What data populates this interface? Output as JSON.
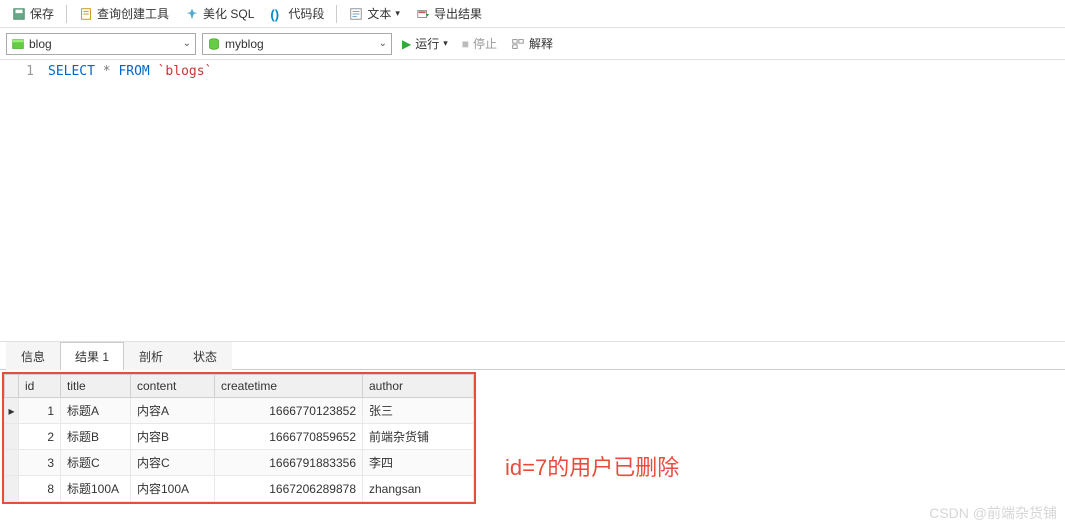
{
  "toolbar": {
    "save": "保存",
    "query_builder": "查询创建工具",
    "beautify_sql": "美化 SQL",
    "code_snippet": "代码段",
    "text": "文本",
    "export": "导出结果"
  },
  "sub_toolbar": {
    "db_select": "blog",
    "table_select": "myblog",
    "run": "运行",
    "stop": "停止",
    "explain": "解释"
  },
  "editor": {
    "line_no": "1",
    "sql_select": "SELECT",
    "sql_star": "*",
    "sql_from": "FROM",
    "sql_table": "`blogs`"
  },
  "tabs": {
    "info": "信息",
    "result1": "结果 1",
    "profile": "剖析",
    "status": "状态"
  },
  "result": {
    "headers": {
      "id": "id",
      "title": "title",
      "content": "content",
      "createtime": "createtime",
      "author": "author"
    },
    "rows": [
      {
        "id": "1",
        "title": "标题A",
        "content": "内容A",
        "createtime": "1666770123852",
        "author": "张三",
        "selected": true
      },
      {
        "id": "2",
        "title": "标题B",
        "content": "内容B",
        "createtime": "1666770859652",
        "author": "前端杂货铺",
        "selected": false
      },
      {
        "id": "3",
        "title": "标题C",
        "content": "内容C",
        "createtime": "1666791883356",
        "author": "李四",
        "selected": false
      },
      {
        "id": "8",
        "title": "标题100A",
        "content": "内容100A",
        "createtime": "1667206289878",
        "author": "zhangsan",
        "selected": false
      }
    ]
  },
  "annotation": "id=7的用户已删除",
  "watermark": "CSDN @前端杂货铺"
}
